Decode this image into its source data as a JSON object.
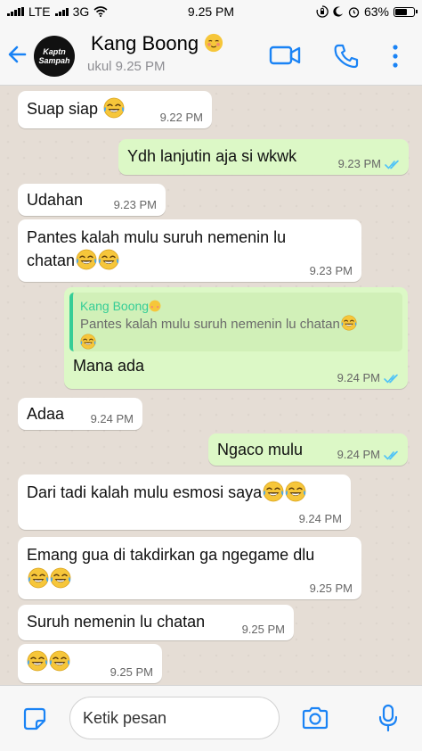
{
  "status_bar": {
    "carrier": "LTE",
    "network": "3G",
    "time": "9.25 PM",
    "battery": "63%"
  },
  "header": {
    "contact_name": "Kang Boong",
    "last_seen": "ukul 9.25 PM",
    "avatar_text": "Kaptn Sampah"
  },
  "colors": {
    "accent": "#1a83f5",
    "incoming": "#ffffff",
    "outgoing": "#dcf8c6",
    "read_ticks": "#4fc3f7",
    "quote_name": "#35cd96",
    "emoji": "#f6c63a"
  },
  "messages": [
    {
      "direction": "in",
      "text": "Suap siap",
      "emoji": "joy",
      "time": "9.22 PM"
    },
    {
      "direction": "out",
      "text": "Ydh lanjutin aja si wkwk",
      "time": "9.23 PM",
      "status": "read"
    },
    {
      "direction": "in",
      "text": "Udahan",
      "time": "9.23 PM"
    },
    {
      "direction": "in",
      "text": "Pantes kalah mulu suruh nemenin lu",
      "text2": "chatan",
      "emoji": "joy joy",
      "time": "9.23 PM"
    },
    {
      "direction": "out",
      "quote_name": "Kang Boong",
      "quote_text": "Pantes kalah mulu suruh nemenin lu chatan",
      "text": "Mana ada",
      "time": "9.24 PM",
      "status": "read"
    },
    {
      "direction": "in",
      "text": "Adaa",
      "time": "9.24 PM"
    },
    {
      "direction": "out",
      "text": "Ngaco mulu",
      "time": "9.24 PM",
      "status": "read"
    },
    {
      "direction": "in",
      "text": "Dari tadi kalah mulu esmosi saya",
      "emoji": "joy joy",
      "time": "9.24 PM"
    },
    {
      "direction": "in",
      "text": "Emang gua di takdirkan ga ngegame dlu",
      "emoji": "joy joy",
      "time": "9.25 PM"
    },
    {
      "direction": "in",
      "text": "Suruh nemenin lu chatan",
      "time": "9.25 PM"
    },
    {
      "direction": "in",
      "text": "",
      "emoji": "joy joy",
      "time": "9.25 PM"
    }
  ],
  "input": {
    "placeholder": "Ketik pesan"
  },
  "icons": {
    "back": "chevron-left-icon",
    "video": "video-camera-icon",
    "call": "phone-icon",
    "more": "more-vertical-icon",
    "sticker": "sticker-icon",
    "camera": "camera-icon",
    "mic": "microphone-icon"
  }
}
